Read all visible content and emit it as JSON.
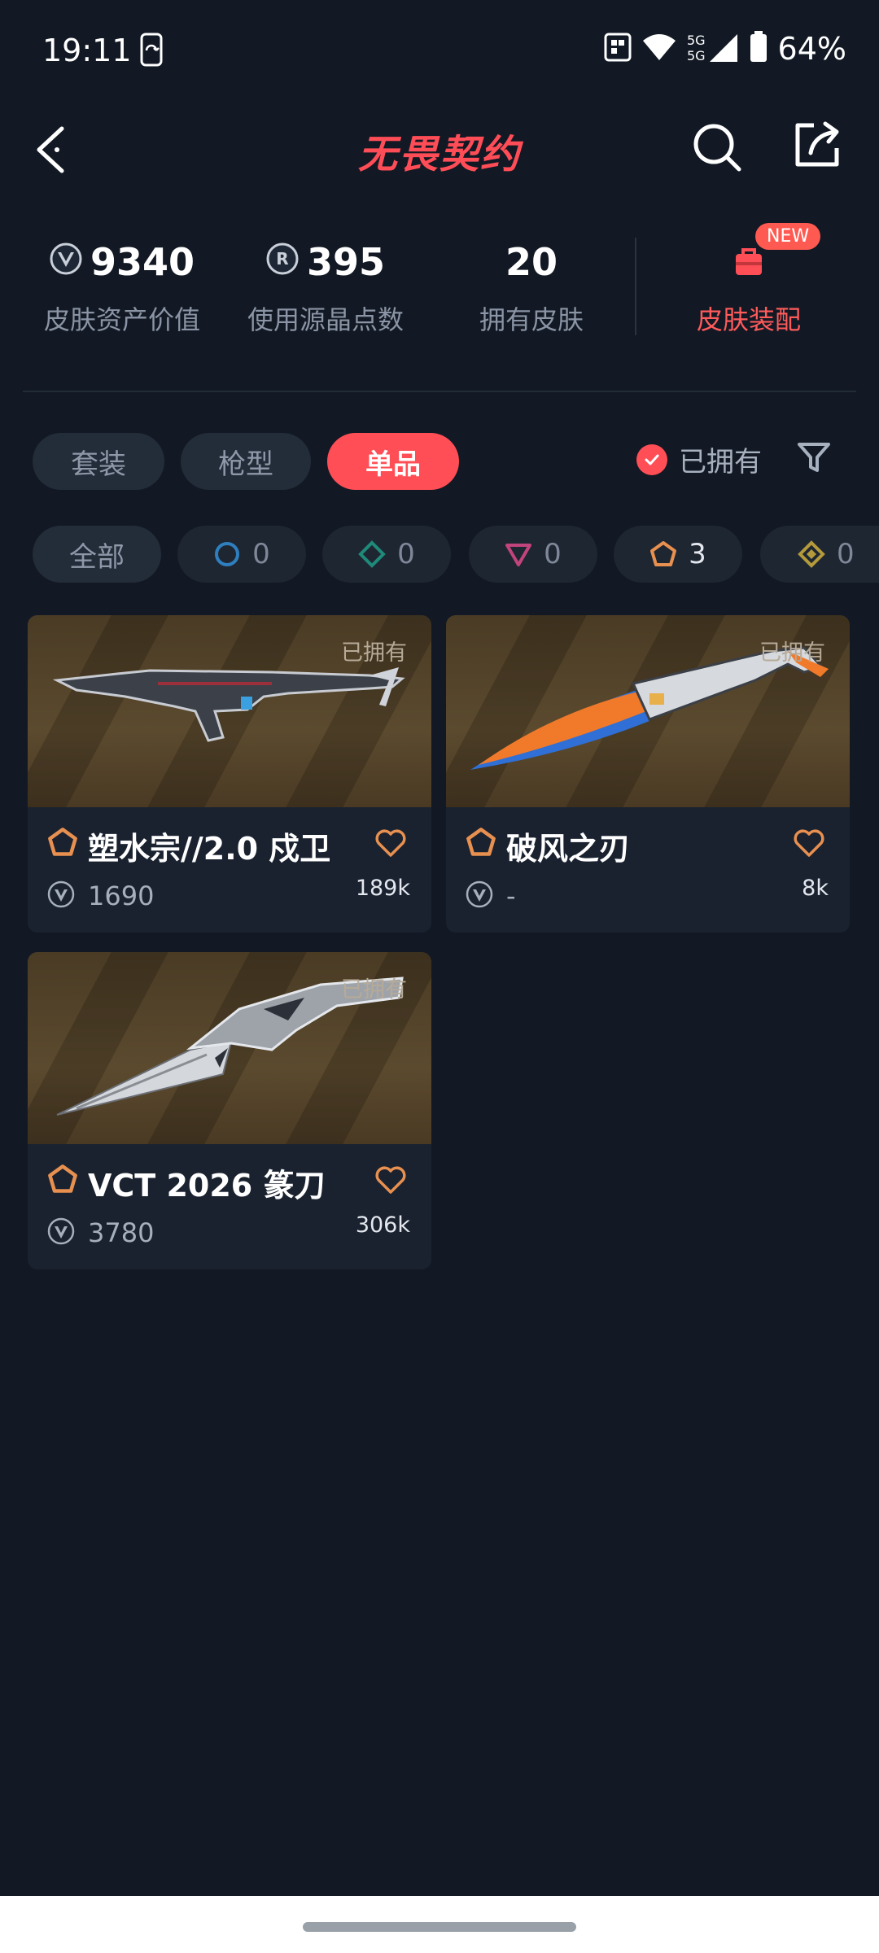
{
  "status": {
    "time": "19:11",
    "battery": "64%",
    "network": "5G 5G"
  },
  "header": {
    "title": "无畏契约"
  },
  "stats": [
    {
      "value": "9340",
      "label": "皮肤资产价值",
      "icon": "vp-icon"
    },
    {
      "value": "395",
      "label": "使用源晶点数",
      "icon": "radianite-icon"
    },
    {
      "value": "20",
      "label": "拥有皮肤",
      "icon": ""
    }
  ],
  "equip": {
    "label": "皮肤装配",
    "badge": "NEW"
  },
  "tabs": [
    {
      "label": "套装",
      "active": false
    },
    {
      "label": "枪型",
      "active": false
    },
    {
      "label": "单品",
      "active": true
    }
  ],
  "owned_filter": {
    "label": "已拥有",
    "checked": true
  },
  "tiers": {
    "all_label": "全部",
    "items": [
      {
        "name": "select",
        "count": "0",
        "color": "#2f7fbf"
      },
      {
        "name": "deluxe",
        "count": "0",
        "color": "#1f8a7a"
      },
      {
        "name": "premium",
        "count": "0",
        "color": "#c2447c"
      },
      {
        "name": "exclusive",
        "count": "3",
        "color": "#e8904f"
      },
      {
        "name": "ultra",
        "count": "0",
        "color": "#b49a3a"
      }
    ]
  },
  "skins": [
    {
      "name": "塑水宗//2.0 戍卫",
      "owned_label": "已拥有",
      "price": "1690",
      "likes": "189k",
      "tier_color": "#e8904f"
    },
    {
      "name": "破风之刃",
      "owned_label": "已拥有",
      "price": "-",
      "likes": "8k",
      "tier_color": "#e8904f"
    },
    {
      "name": "VCT 2026 篆刀",
      "owned_label": "已拥有",
      "price": "3780",
      "likes": "306k",
      "tier_color": "#e8904f"
    }
  ]
}
